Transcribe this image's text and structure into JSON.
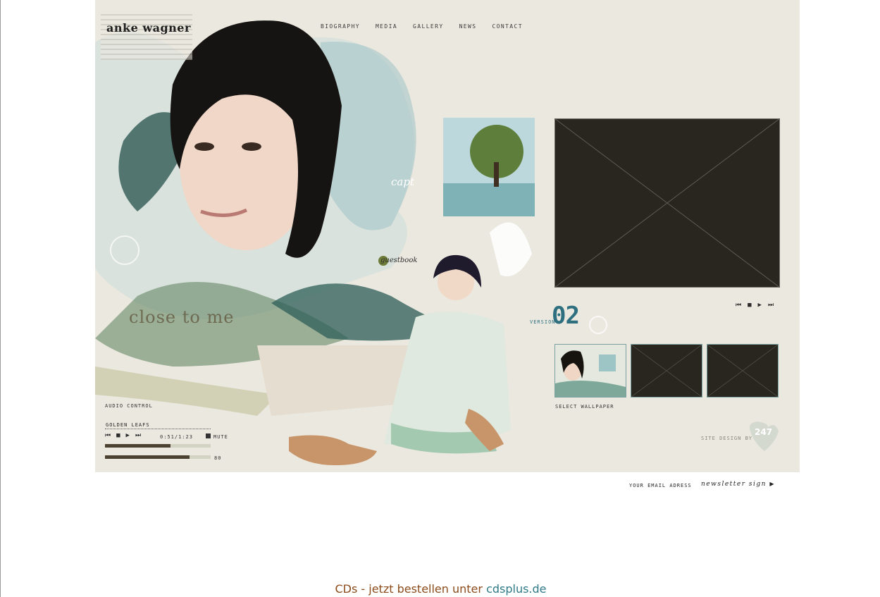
{
  "site": {
    "logo": "anke wagner"
  },
  "nav": {
    "items": [
      {
        "label": "BIOGRAPHY"
      },
      {
        "label": "MEDIA"
      },
      {
        "label": "GALLERY"
      },
      {
        "label": "NEWS"
      },
      {
        "label": "CONTACT"
      }
    ]
  },
  "artwork": {
    "headline": "close to me",
    "capt_label": "capt",
    "guestbook_label": "guestbook"
  },
  "version": {
    "label": "VERSION",
    "number": "02"
  },
  "audio": {
    "section_label": "AUDIO CONTROL",
    "track_title": "GOLDEN LEAFS",
    "time": "0:51/1:23",
    "mute_label": "MUTE",
    "volume_value": "80",
    "progress_fraction": 0.62,
    "volume_fraction": 0.8
  },
  "wallpaper": {
    "label": "SELECT WALLPAPER"
  },
  "credit": {
    "label": "SITE DESIGN BY",
    "badge": "247"
  },
  "newsletter": {
    "email_label": "YOUR EMAIL ADRESS",
    "sign_label": "newsletter sign"
  },
  "footer": {
    "text": "CDs - jetzt bestellen unter",
    "link": "cdsplus.de"
  },
  "colors": {
    "accent": "#2e6f80",
    "background": "#ebe8df",
    "dark_panel": "#29261f"
  }
}
